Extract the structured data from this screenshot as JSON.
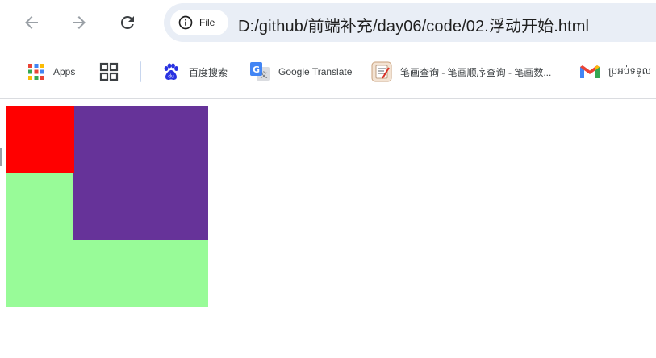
{
  "toolbar": {
    "back_label": "Back",
    "forward_label": "Forward",
    "reload_label": "Reload"
  },
  "omnibox": {
    "security_chip": "File",
    "url": "D:/github/前端补充/day06/code/02.浮动开始.html"
  },
  "bookmarks": {
    "apps": "Apps",
    "baidu": "百度搜索",
    "translate": "Google Translate",
    "bihua": "笔画查询 - 笔画顺序查询 - 笔画数...",
    "gmail": "ប្រអប់ទទួល"
  },
  "colors": {
    "red_box": "#ff0000",
    "purple_box": "#663399",
    "green_box": "#98fb98",
    "omnibox_bg": "#e9eef6"
  }
}
